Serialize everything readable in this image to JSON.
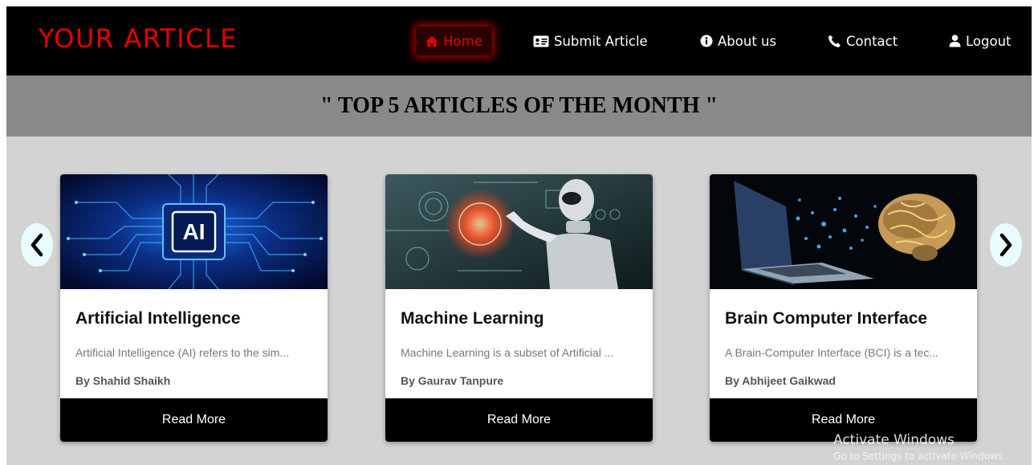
{
  "header": {
    "logo": "YOUR ARTICLE",
    "nav": {
      "home": "Home",
      "submit": "Submit Article",
      "about": "About us",
      "contact": "Contact",
      "logout": "Logout"
    },
    "colors": {
      "logo": "#e60000",
      "active": "#e60000",
      "bar": "#000000"
    }
  },
  "page": {
    "title": "\" TOP 5 ARTICLES OF THE MONTH \""
  },
  "carousel": {
    "prev_icon": "chevron-left-icon",
    "next_icon": "chevron-right-icon",
    "cards": [
      {
        "title": "Artificial Intelligence",
        "description": "Artificial Intelligence (AI) refers to the sim...",
        "author": "By Shahid Shaikh",
        "button": "Read More",
        "image_label": "AI"
      },
      {
        "title": "Machine Learning",
        "description": "Machine Learning is a subset of Artificial ...",
        "author": "By Gaurav Tanpure",
        "button": "Read More"
      },
      {
        "title": "Brain Computer Interface",
        "description": "A Brain-Computer Interface (BCI) is a tec...",
        "author": "By Abhijeet Gaikwad",
        "button": "Read More"
      }
    ]
  },
  "watermark": {
    "title": "Activate Windows",
    "subtitle": "Go to Settings to activate Windows."
  }
}
